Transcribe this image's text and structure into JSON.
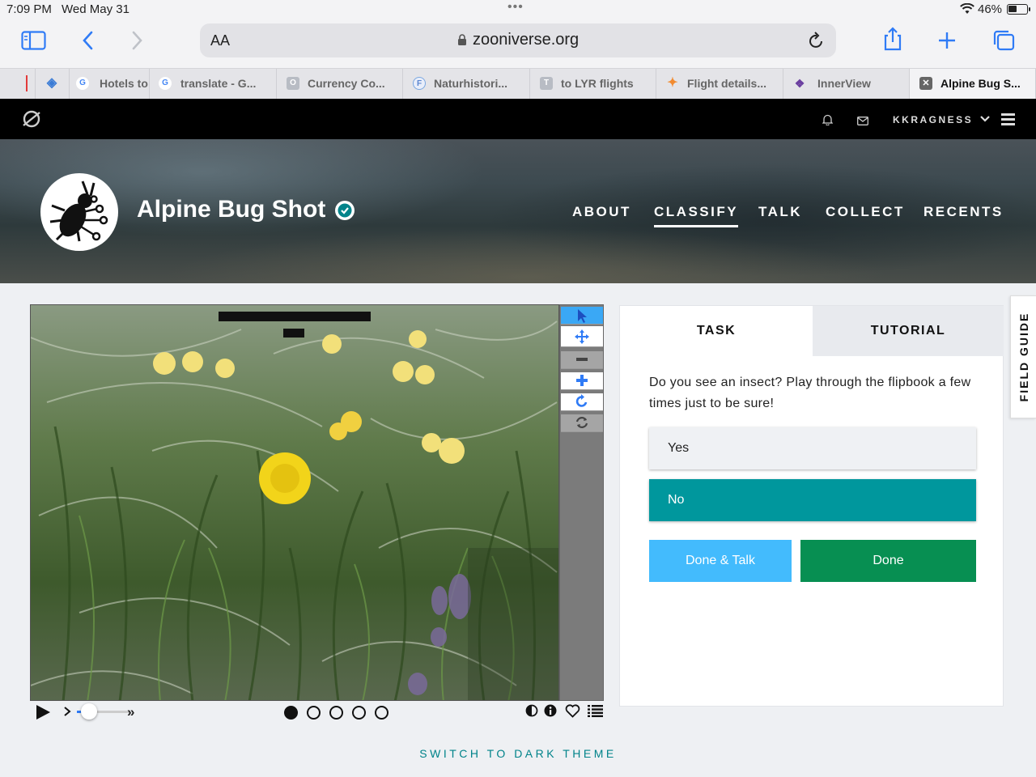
{
  "status_bar": {
    "time": "7:09 PM",
    "date": "Wed May 31",
    "battery": "46%"
  },
  "browser": {
    "text_size_label": "AA",
    "url": "zooniverse.org",
    "tabs": [
      {
        "label": "",
        "favicon": "diamond-icon",
        "color": "#3a7bd5"
      },
      {
        "label": "Hotels to",
        "favicon": "google-icon",
        "color": "#4285f4"
      },
      {
        "label": "translate - G...",
        "favicon": "google-icon",
        "color": "#4285f4"
      },
      {
        "label": "Currency Co...",
        "favicon": "letter-o-icon",
        "color": "#b8bcc4"
      },
      {
        "label": "Naturhistori...",
        "favicon": "letter-f-icon",
        "color": "#7aa7e0"
      },
      {
        "label": "to LYR flights",
        "favicon": "letter-t-icon",
        "color": "#b8bcc4"
      },
      {
        "label": "Flight details...",
        "favicon": "sparkle-icon",
        "color": "#f28b30"
      },
      {
        "label": "InnerView",
        "favicon": "innerview-icon",
        "color": "#6b3fa0"
      },
      {
        "label": "Alpine Bug S...",
        "favicon": "close-icon",
        "color": "#555"
      }
    ]
  },
  "zooniverse_nav": {
    "username": "KKRAGNESS"
  },
  "project": {
    "title": "Alpine Bug Shot",
    "nav": [
      "ABOUT",
      "CLASSIFY",
      "TALK",
      "COLLECT",
      "RECENTS"
    ],
    "active_nav": "CLASSIFY"
  },
  "task_panel": {
    "tabs": [
      "TASK",
      "TUTORIAL"
    ],
    "question": "Do you see an insect? Play through the flipbook a few times just to be sure!",
    "answers": [
      "Yes",
      "No"
    ],
    "selected_answer": "No",
    "done_talk_label": "Done & Talk",
    "done_label": "Done"
  },
  "flipbook": {
    "frames": 5,
    "current_frame": 1
  },
  "field_guide_label": "FIELD GUIDE",
  "theme_toggle_label": "SWITCH TO DARK THEME",
  "colors": {
    "accent_teal": "#00979d",
    "done_green": "#078f52",
    "done_talk_blue": "#43bbfd",
    "safari_blue": "#2f7bf6"
  }
}
